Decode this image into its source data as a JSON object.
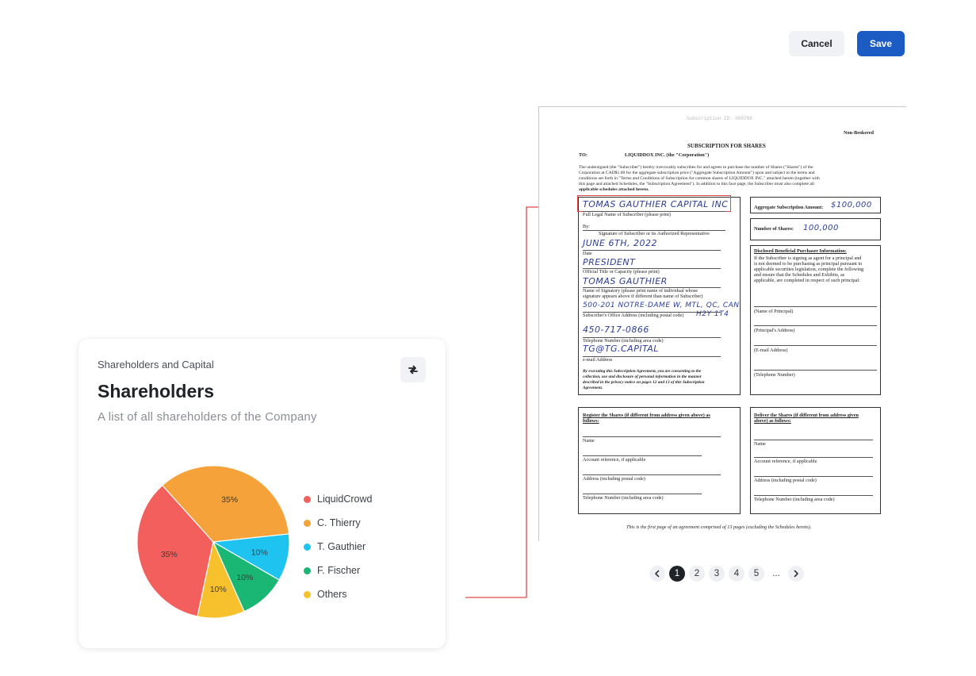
{
  "toolbar": {
    "cancel_label": "Cancel",
    "save_label": "Save"
  },
  "card": {
    "eyebrow": "Shareholders and Capital",
    "title": "Shareholders",
    "subtitle": "A list of all shareholders of the Company"
  },
  "chart_data": {
    "type": "pie",
    "slices": [
      {
        "name": "LiquidCrowd",
        "value": 35,
        "label": "35%",
        "color": "#f25f5c"
      },
      {
        "name": "C. Thierry",
        "value": 35,
        "label": "35%",
        "color": "#f5a23a"
      },
      {
        "name": "T. Gauthier",
        "value": 10,
        "label": "10%",
        "color": "#1ec3ef"
      },
      {
        "name": "F. Fischer",
        "value": 10,
        "label": "10%",
        "color": "#1ab673"
      },
      {
        "name": "Others",
        "value": 10,
        "label": "10%",
        "color": "#f7c12e"
      }
    ],
    "legend_position": "right"
  },
  "document": {
    "header_code": "Subscription ID: 000788",
    "tag": "Non-Brokered",
    "title": "SUBSCRIPTION FOR SHARES",
    "to_label": "TO:",
    "to_value": "LIQUIDDOX INC. (the \"Corporation\")",
    "intro_1": "The undersigned (the \"Subscriber\") hereby irrevocably subscribes for and agrees to purchase the number of Shares (\"Shares\") of the",
    "intro_2": "Corporation at CAD$1.00 for the aggregate subscription price (\"Aggregate Subscription Amount\") upon and subject to the terms and",
    "intro_3": "conditions set forth in \"Terms and Conditions of Subscription for common shares of LIQUIDDOX INC.\" attached hereto (together with",
    "intro_4": "this page and attached Schedules, the \"Subscription Agreement\"). In addition to this face page, the Subscriber must also complete all",
    "intro_5": "applicable schedules attached hereto.",
    "full_name_hw": "TOMAS GAUTHIER CAPITAL INC",
    "full_name_label": "Full Legal Name of Subscriber (please print)",
    "by_label": "By:",
    "signature_label": "Signature of Subscriber or its Authorized Representative",
    "date_hw": "JUNE 6TH, 2022",
    "date_label": "Date",
    "title_hw": "PRESIDENT",
    "title_label": "Official Title or Capacity (please print)",
    "signatory_hw": "TOMAS GAUTHIER",
    "signatory_label_1": "Name of Signatory (please print name of individual whose",
    "signatory_label_2": "signature appears above if different than name of Subscriber)",
    "address_hw": "500-201 NOTRE-DAME W, MTL, QC, CAN",
    "address_label": "Subscriber's Office Address (including postal code)",
    "postal_hw": "H2Y 1T4",
    "phone_hw": "450-717-0866",
    "phone_label": "Telephone Number (including area code)",
    "email_hw": "TG@TG.CAPITAL",
    "email_label": "e-mail Address",
    "consent_1": "By executing this Subscription Agreement, you are consenting to the",
    "consent_2": "collection, use and disclosure of personal information in the manner",
    "consent_3": "described in the privacy notice on pages 12 and 13 of this Subscription",
    "consent_4": "Agreement.",
    "amount_label": "Aggregate Subscription Amount:",
    "amount_hw": "$100,000",
    "shares_label": "Number of Shares:",
    "shares_hw": "100,000",
    "disclosed_title": "Disclosed Beneficial Purchaser Information:",
    "disclosed_1": "If the Subscriber is signing as agent for a principal and",
    "disclosed_2": "is not deemed to be purchasing as principal pursuant to",
    "disclosed_3": "applicable securities legislation, complete the following",
    "disclosed_4": "and ensure that the Schedules and Exhibits, as",
    "disclosed_5": "applicable, are completed in respect of such principal:",
    "principal_name": "(Name of Principal)",
    "principal_address": "(Principal's Address)",
    "principal_email": "(E-mail Address)",
    "principal_phone": "(Telephone Number)",
    "register_title_1": "Register the Shares (if different from address given above) as",
    "register_title_2": "follows:",
    "deliver_title_1": "Deliver the Shares (if different from address given",
    "deliver_title_2": "above) as follows:",
    "f_name": "Name",
    "f_account": "Account reference, if applicable",
    "f_address": "Address (including postal code)",
    "f_phone": "Telephone Number (including area code)",
    "footer": "This is the first page of an agreement comprised of 13 pages (excluding the Schedules hereto)."
  },
  "pagination": {
    "prev_icon": "chevron-left-icon",
    "next_icon": "chevron-right-icon",
    "pages": [
      "1",
      "2",
      "3",
      "4",
      "5"
    ],
    "ellipsis": "...",
    "current": "1"
  },
  "colors": {
    "accent": "#1a5bc4",
    "highlight": "#e04848",
    "ink": "#2b3d9a"
  }
}
